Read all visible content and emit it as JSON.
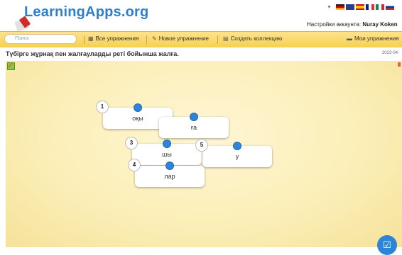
{
  "header": {
    "logo_text": "LearningApps.org",
    "account_label": "Настройки аккаунта:",
    "account_name": "Nuray Koken"
  },
  "toolbar": {
    "search_placeholder": "Поиск",
    "all_exercises": "Все упражнения",
    "new_exercise": "Новое упражнение",
    "create_collection": "Создать коллекцию",
    "my_exercises": "Мои упражнения"
  },
  "page": {
    "title": "Түбірге жұрнақ пен жалғауларды реті бойынша жалға.",
    "date": "2023-04-"
  },
  "cards": [
    {
      "number": "1",
      "text": "оқы"
    },
    {
      "number": "",
      "text": "ға"
    },
    {
      "number": "3",
      "text": "шы"
    },
    {
      "number": "5",
      "text": "у"
    },
    {
      "number": "4",
      "text": "лар"
    }
  ],
  "colors": {
    "accent": "#2e84d6",
    "toolbar": "#f7cf52",
    "board": "#fbeeb5"
  }
}
